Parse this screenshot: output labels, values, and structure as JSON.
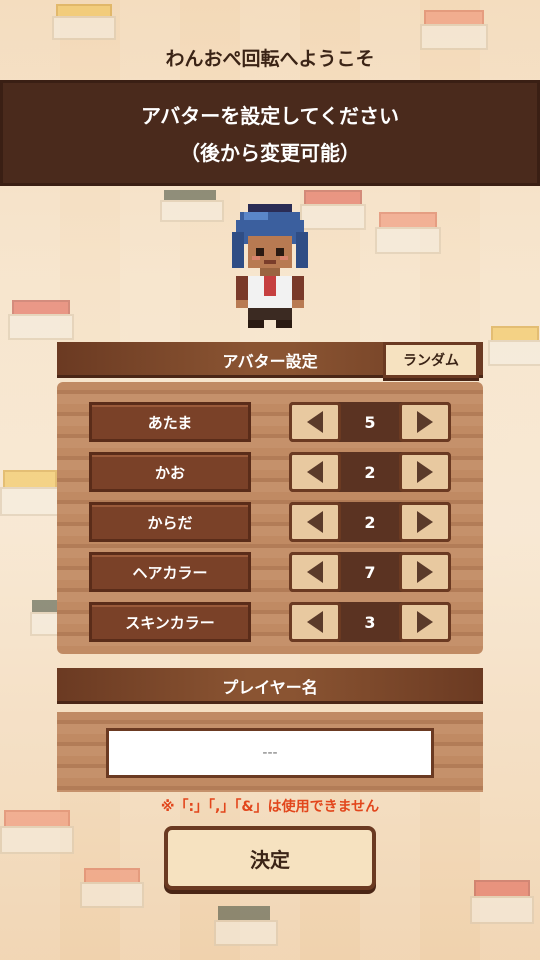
{
  "welcome_text": "わんおぺ回転へようこそ",
  "banner": {
    "line1": "アバターを設定してください",
    "line2": "（後から変更可能）"
  },
  "avatar_settings": {
    "header": "アバター設定",
    "random_label": "ランダム",
    "rows": [
      {
        "label": "あたま",
        "value": "5"
      },
      {
        "label": "かお",
        "value": "2"
      },
      {
        "label": "からだ",
        "value": "2"
      },
      {
        "label": "ヘアカラー",
        "value": "7"
      },
      {
        "label": "スキンカラー",
        "value": "3"
      }
    ]
  },
  "player_name": {
    "header": "プレイヤー名",
    "placeholder": "---",
    "value": ""
  },
  "note": "※「:」「,」「&」は使用できません",
  "confirm_label": "決定",
  "colors": {
    "banner": "#4a2a1c",
    "panel_header": "#8a5432",
    "row_label": "#7a4128",
    "note": "#e2461c"
  }
}
